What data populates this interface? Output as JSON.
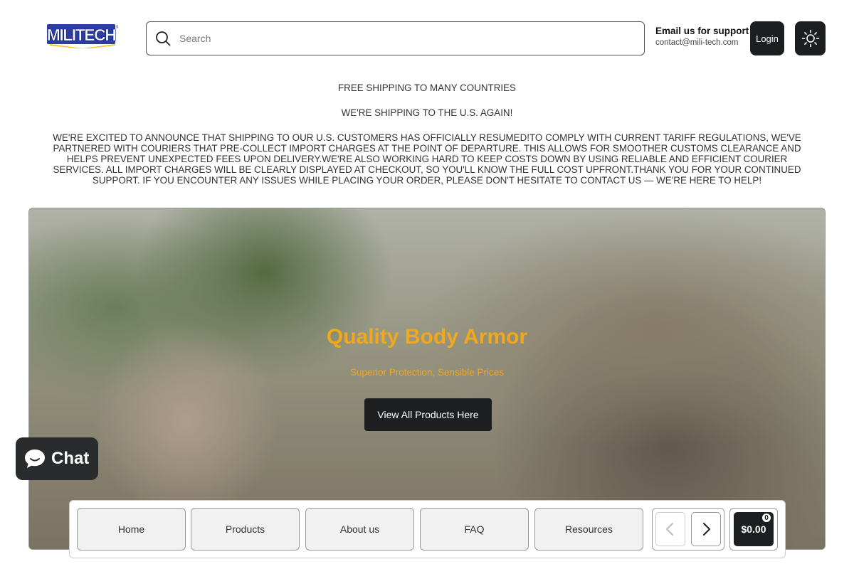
{
  "header": {
    "logo_text": "MILITECH",
    "search": {
      "placeholder": "Search"
    },
    "support": {
      "title": "Email us for support",
      "email": "contact@mili-tech.com"
    },
    "login_label": "Login",
    "theme_icon": "sun-icon"
  },
  "announcement": {
    "line1": "FREE SHIPPING TO MANY COUNTRIES",
    "line2": "WE'RE SHIPPING TO THE U.S. AGAIN!",
    "body": "WE'RE EXCITED TO ANNOUNCE THAT SHIPPING TO OUR U.S. CUSTOMERS HAS OFFICIALLY RESUMED!TO COMPLY WITH CURRENT TARIFF REGULATIONS, WE'VE PARTNERED WITH COURIERS THAT PRE-COLLECT IMPORT CHARGES AT THE POINT OF DEPARTURE. THIS ALLOWS FOR SMOOTHER CUSTOMS CLEARANCE AND HELPS PREVENT UNEXPECTED FEES UPON DELIVERY.WE'RE ALSO WORKING HARD TO KEEP COSTS DOWN BY USING RELIABLE AND EFFICIENT COURIER SERVICES. ALL IMPORT CHARGES WILL BE CLEARLY DISPLAYED AT CHECKOUT, SO YOU'LL KNOW THE FULL COST UPFRONT.THANK YOU FOR YOUR CONTINUED SUPPORT. IF YOU ENCOUNTER ANY ISSUES WHILE PLACING YOUR ORDER, PLEASE DON'T HESITATE TO CONTACT US — WE'RE HERE TO HELP!"
  },
  "hero": {
    "title": "Quality Body Armor",
    "subtitle": "Superior Protection, Sensible Prices",
    "button_label": "View All Products Here",
    "accent_color": "#f0a81c"
  },
  "chat": {
    "label": "Chat",
    "icon": "chat-bubble-icon"
  },
  "bottom_nav": {
    "items": [
      {
        "label": "Home"
      },
      {
        "label": "Products"
      },
      {
        "label": "About us"
      },
      {
        "label": "FAQ"
      },
      {
        "label": "Resources"
      }
    ],
    "prev_icon": "chevron-left-icon",
    "next_icon": "chevron-right-icon",
    "cart": {
      "total": "$0.00",
      "count": "0"
    }
  }
}
